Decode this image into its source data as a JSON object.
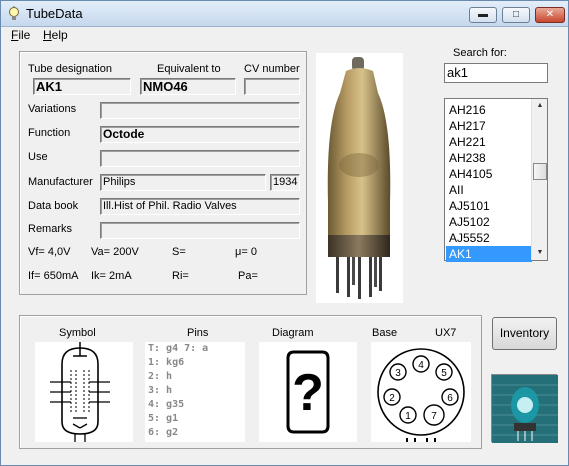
{
  "window": {
    "title": "TubeData"
  },
  "menu": [
    {
      "label": "File",
      "accel": "F"
    },
    {
      "label": "Help",
      "accel": "H"
    }
  ],
  "labels": {
    "tube_designation": "Tube designation",
    "equivalent_to": "Equivalent to",
    "cv_number": "CV number",
    "variations": "Variations",
    "function": "Function",
    "use": "Use",
    "manufacturer": "Manufacturer",
    "data_book": "Data book",
    "remarks": "Remarks"
  },
  "values": {
    "tube_designation": "AK1",
    "equivalent_to": "NMO46",
    "cv_number": "",
    "variations": "",
    "function": "Octode",
    "use": "",
    "manufacturer": "Philips",
    "year": "1934",
    "data_book": "Ill.Hist of Phil. Radio Valves",
    "remarks": ""
  },
  "params": {
    "vf": "Vf= 4,0V",
    "va": "Va= 200V",
    "s": "S=",
    "mu": "μ=   0",
    "if": "If= 650mA",
    "ik": "Ik=  2mA",
    "ri": "Ri=",
    "pa": "Pa="
  },
  "search": {
    "label": "Search for:",
    "value": "ak1"
  },
  "tube_list": [
    "AH216",
    "AH217",
    "AH221",
    "AH238",
    "AH4105",
    "AII",
    "AJ5101",
    "AJ5102",
    "AJ5552",
    "AK1"
  ],
  "selected_tube": "AK1",
  "bottom": {
    "symbol_label": "Symbol",
    "pins_label": "Pins",
    "diagram_label": "Diagram",
    "base_label": "Base",
    "base_type": "UX7",
    "pins_lines": [
      "T: g4     7: a",
      "1: kg6",
      "2: h",
      "3: h",
      "4: g35",
      "5: g1",
      "6: g2"
    ],
    "diagram_placeholder": "?",
    "base_pins": [
      "3",
      "4",
      "5",
      "2",
      "6",
      "1",
      "7"
    ]
  },
  "buttons": {
    "inventory": "Inventory"
  },
  "colors": {
    "selection": "#3399ff",
    "title_gradient_top": "#e3eef9",
    "close_button": "#c7462e"
  }
}
